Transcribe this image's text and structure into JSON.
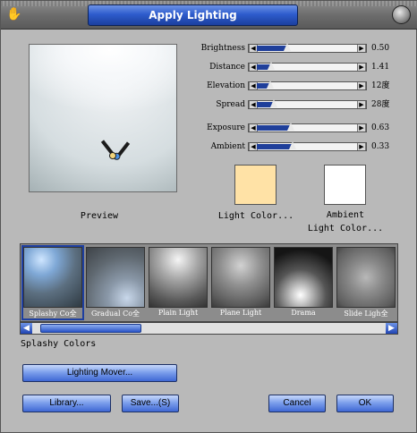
{
  "window": {
    "title": "Apply Lighting",
    "title_icon": "hand-icon",
    "close_icon": "close-icon"
  },
  "preview": {
    "caption": "Preview",
    "light_colors": [
      "#4a90e2",
      "#f2d47a"
    ]
  },
  "sliders": [
    {
      "label": "Brightness",
      "value": "0.50",
      "level": 0.3
    },
    {
      "label": "Distance",
      "value": "1.41",
      "level": 0.14
    },
    {
      "label": "Elevation",
      "value": "12度",
      "level": 0.13
    },
    {
      "label": "Spread",
      "value": "28度",
      "level": 0.17
    },
    {
      "label": "Exposure",
      "value": "0.63",
      "level": 0.34
    },
    {
      "label": "Ambient",
      "value": "0.33",
      "level": 0.35
    }
  ],
  "colors": {
    "light": {
      "label": "Light Color...",
      "color": "#ffe2a6"
    },
    "ambient": {
      "label_line1": "Ambient",
      "label_line2": "Light Color...",
      "color": "#ffffff"
    }
  },
  "presets": {
    "items": [
      {
        "name": "Splashy Co全",
        "selected": true
      },
      {
        "name": "Gradual Co全",
        "selected": false
      },
      {
        "name": "Plain Light",
        "selected": false
      },
      {
        "name": "Plane Light",
        "selected": false
      },
      {
        "name": "Drama",
        "selected": false
      },
      {
        "name": "Slide Ligh全",
        "selected": false
      }
    ],
    "selected_name": "Splashy Colors"
  },
  "buttons": {
    "lighting_mover": "Lighting Mover...",
    "library": "Library...",
    "save": "Save...(S)",
    "cancel": "Cancel",
    "ok": "OK"
  },
  "accent": "#2e5ccd"
}
